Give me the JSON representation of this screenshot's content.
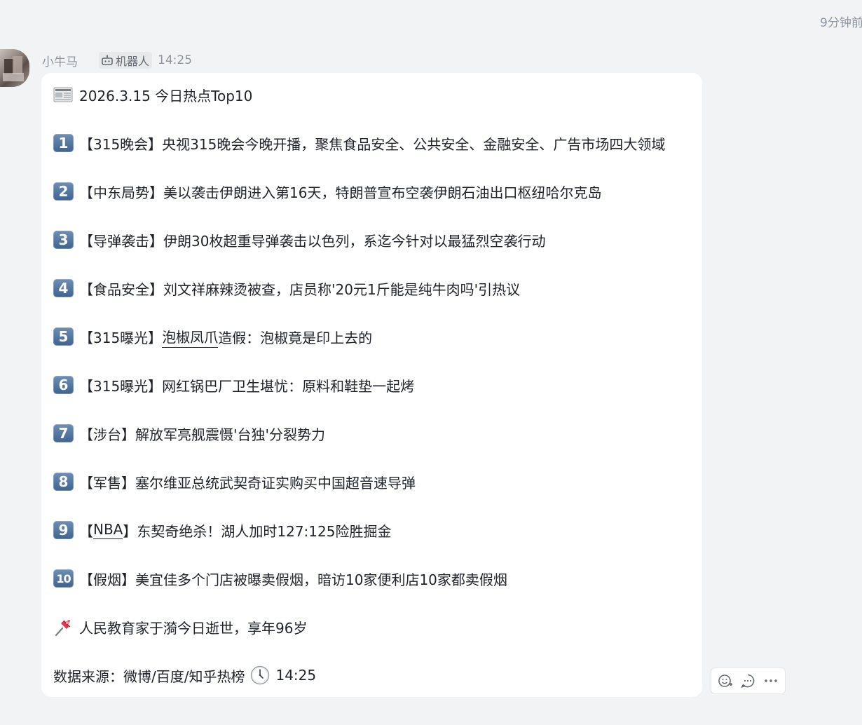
{
  "meta": {
    "time_ago": "9分钟前"
  },
  "message": {
    "sender": "小牛马",
    "bot_tag": "机器人",
    "time": "14:25",
    "title": "2026.3.15 今日热点Top10",
    "items": [
      {
        "num": "1",
        "text": "【315晚会】央视315晚会今晚开播，聚焦食品安全、公共安全、金融安全、广告市场四大领域"
      },
      {
        "num": "2",
        "text": "【中东局势】美以袭击伊朗进入第16天，特朗普宣布空袭伊朗石油出口枢纽哈尔克岛"
      },
      {
        "num": "3",
        "text": "【导弹袭击】伊朗30枚超重导弹袭击以色列，系迄今针对以最猛烈空袭行动"
      },
      {
        "num": "4",
        "text": "【食品安全】刘文祥麻辣烫被查，店员称'20元1斤能是纯牛肉吗'引热议"
      },
      {
        "num": "5",
        "prefix": "【315曝光】",
        "link": "泡椒凤爪",
        "suffix": "造假：泡椒竟是印上去的"
      },
      {
        "num": "6",
        "text": "【315曝光】网红锅巴厂卫生堪忧：原料和鞋垫一起烤"
      },
      {
        "num": "7",
        "text": "【涉台】解放军亮舰震慑'台独'分裂势力"
      },
      {
        "num": "8",
        "text": "【军售】塞尔维亚总统武契奇证实购买中国超音速导弹"
      },
      {
        "num": "9",
        "prefix": "【",
        "link": "NBA",
        "suffix": "】东契奇绝杀！湖人加时127:125险胜掘金"
      },
      {
        "num": "10",
        "text": "【假烟】美宜佳多个门店被曝卖假烟，暗访10家便利店10家都卖假烟"
      }
    ],
    "pinned": "人民教育家于漪今日逝世，享年96岁",
    "source_label": "数据来源：微博/百度/知乎热榜",
    "source_time": "14:25"
  },
  "icons": {
    "accent": "#3f6390",
    "news": "newspaper-icon",
    "pin": "pushpin-icon",
    "clock": "clock-icon",
    "bot": "robot-icon",
    "reaction": "add-reaction-icon",
    "reply": "reply-icon",
    "more": "more-icon"
  }
}
